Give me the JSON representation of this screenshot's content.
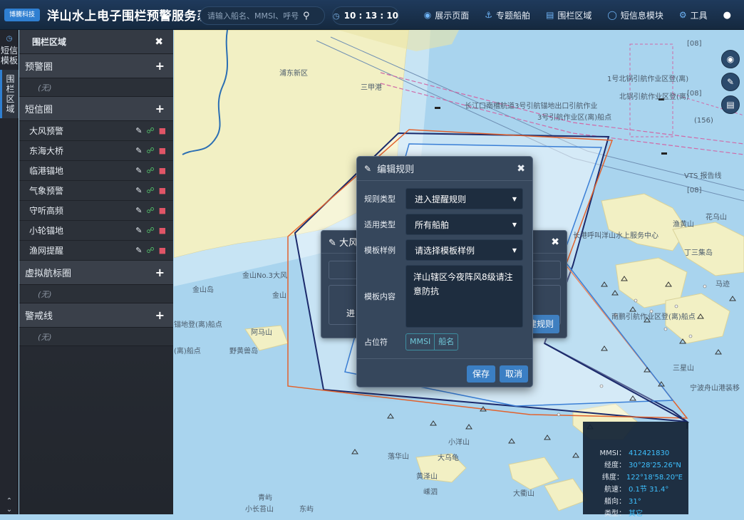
{
  "header": {
    "logo_text": "博騰科技",
    "title": "洋山水上电子围栏预警服务系统",
    "search_placeholder": "请输入船名、MMSI、呼号等",
    "clock": "10 : 13 : 10",
    "menu": [
      {
        "label": "展示页面",
        "icon": "globe-icon"
      },
      {
        "label": "专题船舶",
        "icon": "ship-icon"
      },
      {
        "label": "围栏区域",
        "icon": "chart-icon"
      },
      {
        "label": "短信息模块",
        "icon": "chat-icon"
      },
      {
        "label": "工具",
        "icon": "gear-icon"
      }
    ]
  },
  "leftstrip": {
    "tabs": [
      {
        "label": "短信模板",
        "icon": "clock-icon"
      },
      {
        "label": "围栏区域",
        "icon": ""
      }
    ]
  },
  "sidebar": {
    "title": "围栏区域",
    "sections": [
      {
        "name": "预警圈",
        "empty_text": "(无)",
        "items": []
      },
      {
        "name": "短信圈",
        "items": [
          "大风预警",
          "东海大桥",
          "临港锚地",
          "气象预警",
          "守听高频",
          "小轮锚地",
          "渔网提醒"
        ]
      },
      {
        "name": "虚拟航标圈",
        "empty_text": "(无)",
        "items": []
      },
      {
        "name": "警戒线",
        "empty_text": "(无)",
        "items": []
      }
    ]
  },
  "map": {
    "labels": {
      "pudong": "浦东新区",
      "sanjia": "三甲港",
      "changjiang": "长江口南槽航道3号引航锚地出口引航作业",
      "pilot3": "3号引航作业区(离)船点",
      "pilot1n": "1号北锅引航作业区登(离)",
      "north_pilot": "北锅引航作业区登(离)",
      "jinshan": "金山",
      "jinshan_no3": "金山No.3大风",
      "jinshan_island": "金山岛",
      "anchor_rep": "锚地登(离)船点",
      "nanchang": "(离)船点",
      "ama": "阿马山",
      "yexi": "野黄兽岛",
      "dawumao": "大乌龟",
      "xiaoyang": "小洋山",
      "xiyang": "大衢山",
      "qingshan": "青屿",
      "xiaocao": "小长苔山",
      "dongkuan": "东屿",
      "luohua": "落华山",
      "huangze": "黄泽山",
      "shengsi": "嵊泗",
      "vts": "VTS 报告线",
      "yangshan_vhf": "长港呼叫洋山水上服务中心",
      "ningbo": "宁波舟山港装移",
      "dingxiang": "丁三集岛",
      "maji": "马迹",
      "nanpeng": "南鹏引航作业区登(离)船点",
      "grid08a": "[08]",
      "grid08b": "[08]",
      "grid08c": "[08]",
      "l156": "(156)",
      "yuxi": "渔黄山",
      "huashan": "花乌山",
      "sanxing": "三星山"
    }
  },
  "background_dialog": {
    "title": "大风预",
    "body_text": "进",
    "button": "建规则"
  },
  "dialog": {
    "title": "编辑规则",
    "fields": {
      "rule_type_label": "规则类型",
      "rule_type_value": "进入提醒规则",
      "apply_type_label": "适用类型",
      "apply_type_value": "所有船舶",
      "template_label": "模板样例",
      "template_value": "请选择模板样例",
      "content_label": "模板内容",
      "content_value": "洋山辖区今夜阵风8级请注意防抗",
      "placeholder_label": "占位符"
    },
    "placeholders": [
      "MMSI",
      "船名"
    ],
    "save": "保存",
    "cancel": "取消"
  },
  "vessel_info": {
    "rows": [
      {
        "key": "MMSI：",
        "value": "412421830"
      },
      {
        "key": "经度：",
        "value": "30°28'25.26\"N"
      },
      {
        "key": "纬度：",
        "value": "122°18'58.20\"E"
      },
      {
        "key": "航速：",
        "value": "0.1节 31.4°"
      },
      {
        "key": "艏向：",
        "value": "31°"
      },
      {
        "key": "类型：",
        "value": "其它"
      }
    ]
  }
}
